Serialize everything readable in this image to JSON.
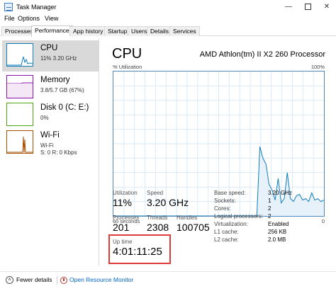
{
  "window": {
    "title": "Task Manager"
  },
  "menu": [
    "File",
    "Options",
    "View"
  ],
  "tabs": [
    "Processes",
    "Performance",
    "App history",
    "Startup",
    "Users",
    "Details",
    "Services"
  ],
  "sidebar": {
    "items": [
      {
        "name": "CPU",
        "sub": "11% 3.20 GHz",
        "color": "#117dbb"
      },
      {
        "name": "Memory",
        "sub": "3.8/5.7 GB (67%)",
        "color": "#8b12ae"
      },
      {
        "name": "Disk 0 (C: E:)",
        "sub": "0%",
        "color": "#4da60c"
      },
      {
        "name": "Wi-Fi",
        "sub": "Wi-Fi",
        "sub2": "S: 0 R: 0 Kbps",
        "color": "#a74f01"
      }
    ]
  },
  "main": {
    "title": "CPU",
    "model": "AMD Athlon(tm) II X2 260 Processor",
    "util_label": "% Utilization",
    "util_max": "100%",
    "seconds_label": "60 seconds",
    "zero_label": "0",
    "graph_color": "#117dbb",
    "graph_series_pct": [
      0,
      0,
      0,
      0,
      0,
      0,
      0,
      0,
      0,
      0,
      0,
      0,
      0,
      0,
      0,
      0,
      0,
      0,
      0,
      0,
      0,
      0,
      0,
      0,
      0,
      0,
      0,
      0,
      0,
      0,
      0,
      0,
      0,
      0,
      0,
      0,
      0,
      0,
      0,
      0,
      0,
      0,
      0,
      0,
      0,
      0,
      0,
      0,
      48,
      40,
      36,
      22,
      18,
      11,
      26,
      9,
      12,
      30,
      12,
      10,
      14,
      15,
      11,
      12,
      10,
      16,
      11,
      12,
      10,
      11
    ],
    "stats": {
      "utilization_label": "Utilization",
      "utilization": "11%",
      "speed_label": "Speed",
      "speed": "3.20 GHz",
      "processes_label": "Processes",
      "processes": "201",
      "threads_label": "Threads",
      "threads": "2308",
      "handles_label": "Handles",
      "handles": "100705",
      "uptime_label": "Up time",
      "uptime": "4:01:11:25"
    },
    "specs": [
      {
        "k": "Base speed:",
        "v": "3.20 GHz"
      },
      {
        "k": "Sockets:",
        "v": "1"
      },
      {
        "k": "Cores:",
        "v": "2"
      },
      {
        "k": "Logical processors:",
        "v": "2"
      },
      {
        "k": "Virtualization:",
        "v": "Enabled"
      },
      {
        "k": "L1 cache:",
        "v": "256 KB"
      },
      {
        "k": "L2 cache:",
        "v": "2.0 MB"
      }
    ],
    "highlight_color": "#e03b3b"
  },
  "footer": {
    "fewer": "Fewer details",
    "monitor": "Open Resource Monitor"
  }
}
